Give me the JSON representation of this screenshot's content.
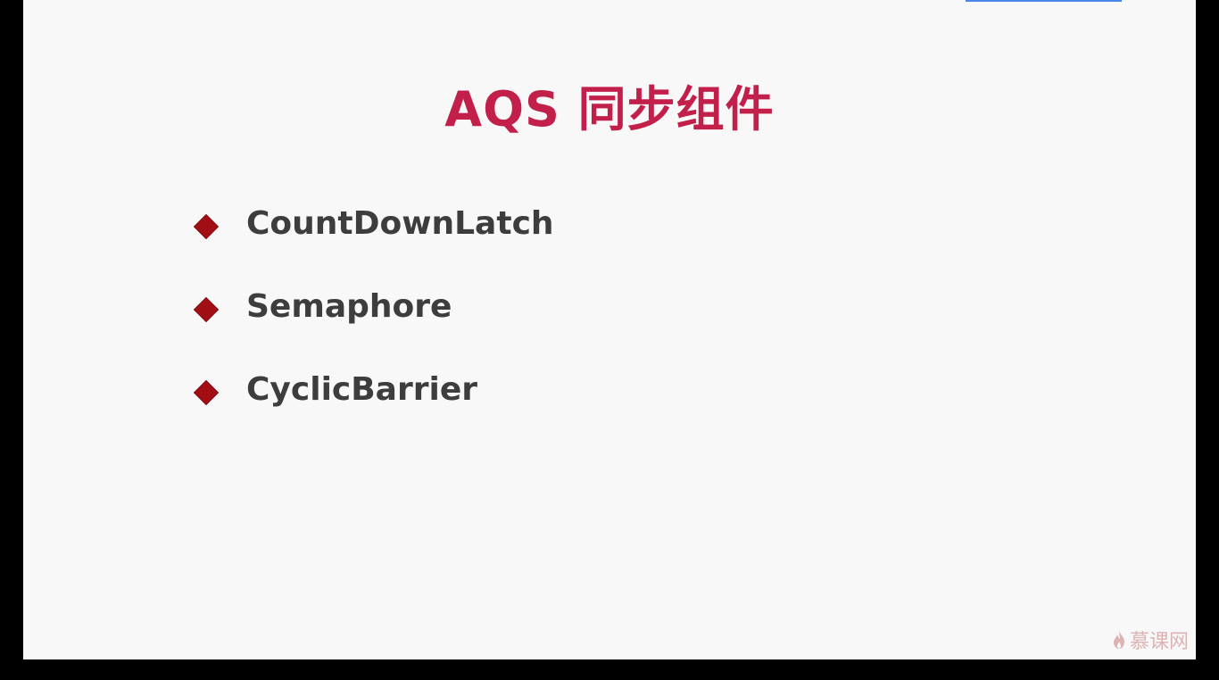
{
  "slide": {
    "title": "AQS 同步组件",
    "bullets": [
      {
        "label": "CountDownLatch",
        "icon": "diamond-bullet-icon"
      },
      {
        "label": "Semaphore",
        "icon": "diamond-bullet-icon"
      },
      {
        "label": "CyclicBarrier",
        "icon": "diamond-bullet-icon"
      }
    ],
    "watermark": "慕课网"
  },
  "colors": {
    "title": "#c21f4a",
    "bullet_marker": "#a10f15",
    "bullet_text": "#3d3d3d",
    "background": "#f8f8f8",
    "frame": "#000000",
    "accent_line": "#4a86e8"
  }
}
